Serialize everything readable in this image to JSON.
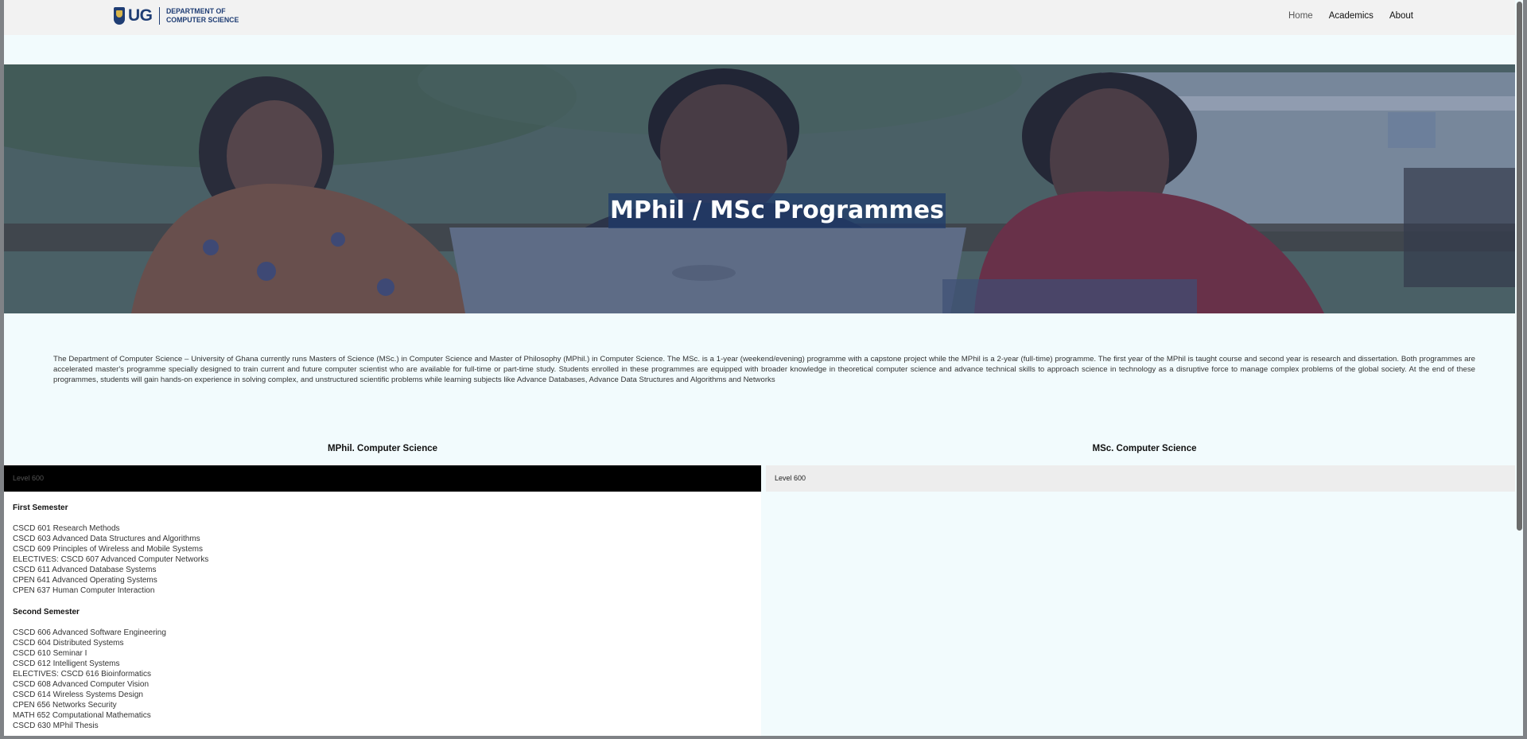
{
  "navbar": {
    "logo_ug": "UG",
    "logo_line1": "DEPARTMENT OF",
    "logo_line2": "COMPUTER SCIENCE",
    "links": [
      "Home",
      "Academics",
      "About"
    ]
  },
  "hero": {
    "title": "MPhil / MSc Programmes"
  },
  "intro": "The Department of Computer Science – University of Ghana currently runs Masters of Science (MSc.) in Computer Science and Master of Philosophy (MPhil.) in Computer Science. The MSc. is a 1-year (weekend/evening) programme with a capstone project while the MPhil is a 2-year (full-time) programme. The first year of the MPhil is taught course and second year is research and dissertation. Both programmes are accelerated master's programme specially designed to train current and future computer scientist who are available for full-time or part-time study. Students enrolled in these programmes are equipped with broader knowledge in theoretical computer science and advance technical skills to approach science in technology as a disruptive force to manage complex problems of the global society. At the end of these programmes, students will gain hands-on experience in solving complex, and unstructured scientific problems while learning subjects like Advance Databases, Advance Data Structures and Algorithms and Networks",
  "mphil": {
    "title": "MPhil. Computer Science",
    "level": "Level 600",
    "first_semester": {
      "title": "First Semester",
      "courses": [
        "CSCD 601 Research Methods",
        "CSCD 603 Advanced Data Structures and Algorithms",
        "CSCD 609 Principles of Wireless and Mobile Systems",
        "ELECTIVES: CSCD 607 Advanced Computer Networks",
        "CSCD 611 Advanced Database Systems",
        "CPEN 641 Advanced Operating Systems",
        "CPEN 637 Human Computer Interaction"
      ]
    },
    "second_semester": {
      "title": "Second Semester",
      "courses": [
        "CSCD 606 Advanced Software Engineering",
        "CSCD 604 Distributed Systems",
        "CSCD 610 Seminar I",
        "CSCD 612 Intelligent Systems",
        "ELECTIVES: CSCD 616 Bioinformatics",
        "CSCD 608 Advanced Computer Vision",
        "CSCD 614 Wireless Systems Design",
        "CPEN 656 Networks Security",
        "MATH 652 Computational Mathematics",
        "CSCD 630 MPhil Thesis"
      ]
    }
  },
  "msc": {
    "title": "MSc. Computer Science",
    "level": "Level 600"
  }
}
